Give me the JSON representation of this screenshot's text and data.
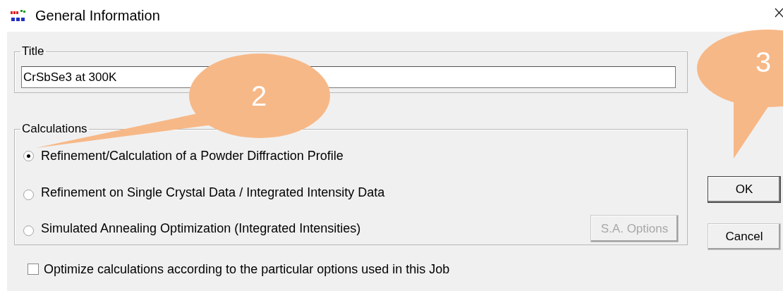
{
  "window": {
    "title": "General Information"
  },
  "title_group": {
    "label": "Title",
    "value": "CrSbSe3 at 300K"
  },
  "calculations": {
    "label": "Calculations",
    "options": [
      {
        "label": "Refinement/Calculation of a Powder Diffraction Profile",
        "selected": true
      },
      {
        "label": "Refinement on Single Crystal Data / Integrated Intensity Data",
        "selected": false
      },
      {
        "label": "Simulated Annealing Optimization (Integrated Intensities)",
        "selected": false
      }
    ],
    "options_button": {
      "label": "S.A. Options",
      "disabled": true
    }
  },
  "optimize": {
    "label": "Optimize calculations according to the particular options used in this Job",
    "checked": false
  },
  "buttons": [
    {
      "label": "OK",
      "default": true
    },
    {
      "label": "Cancel",
      "default": false
    }
  ],
  "callouts": [
    {
      "label": "2"
    },
    {
      "label": "3"
    }
  ]
}
